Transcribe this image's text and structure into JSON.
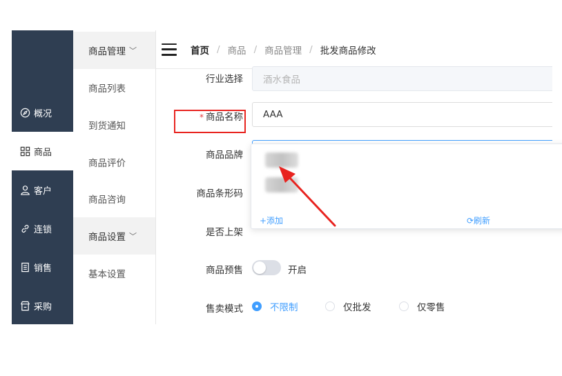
{
  "sidebar_primary": {
    "items": [
      {
        "label": "概况",
        "icon": "compass-icon",
        "active": false
      },
      {
        "label": "商品",
        "icon": "grid-icon",
        "active": true
      },
      {
        "label": "客户",
        "icon": "user-icon",
        "active": false
      },
      {
        "label": "连锁",
        "icon": "link-icon",
        "active": false
      },
      {
        "label": "销售",
        "icon": "receipt-icon",
        "active": false
      },
      {
        "label": "采购",
        "icon": "shop-icon",
        "active": false
      }
    ]
  },
  "sidebar_secondary": {
    "groups": [
      {
        "label": "商品管理",
        "items": [
          "商品列表",
          "到货通知",
          "商品评价",
          "商品咨询"
        ]
      },
      {
        "label": "商品设置",
        "items": [
          "基本设置"
        ]
      }
    ]
  },
  "header": {
    "breadcrumb": [
      "首页",
      "商品",
      "商品管理",
      "批发商品修改"
    ],
    "separator": "/"
  },
  "form": {
    "industry": {
      "label": "行业选择",
      "value": "酒水食品"
    },
    "name": {
      "label": "商品名称",
      "required_mark": "*",
      "value": "AAA"
    },
    "brand": {
      "label": "商品品牌"
    },
    "barcode": {
      "label": "商品条形码"
    },
    "on_shelf": {
      "label": "是否上架"
    },
    "presale": {
      "label": "商品预售",
      "switch_text": "开启",
      "enabled": false
    },
    "sale_mode": {
      "label": "售卖模式",
      "options": [
        "不限制",
        "仅批发",
        "仅零售"
      ],
      "selected": "不限制"
    }
  },
  "brand_dropdown": {
    "add_label": "+添加",
    "refresh_label": "⟳刷新"
  },
  "colors": {
    "sidebar_bg": "#2f3e52",
    "accent": "#409eff",
    "highlight": "#e8231f"
  }
}
